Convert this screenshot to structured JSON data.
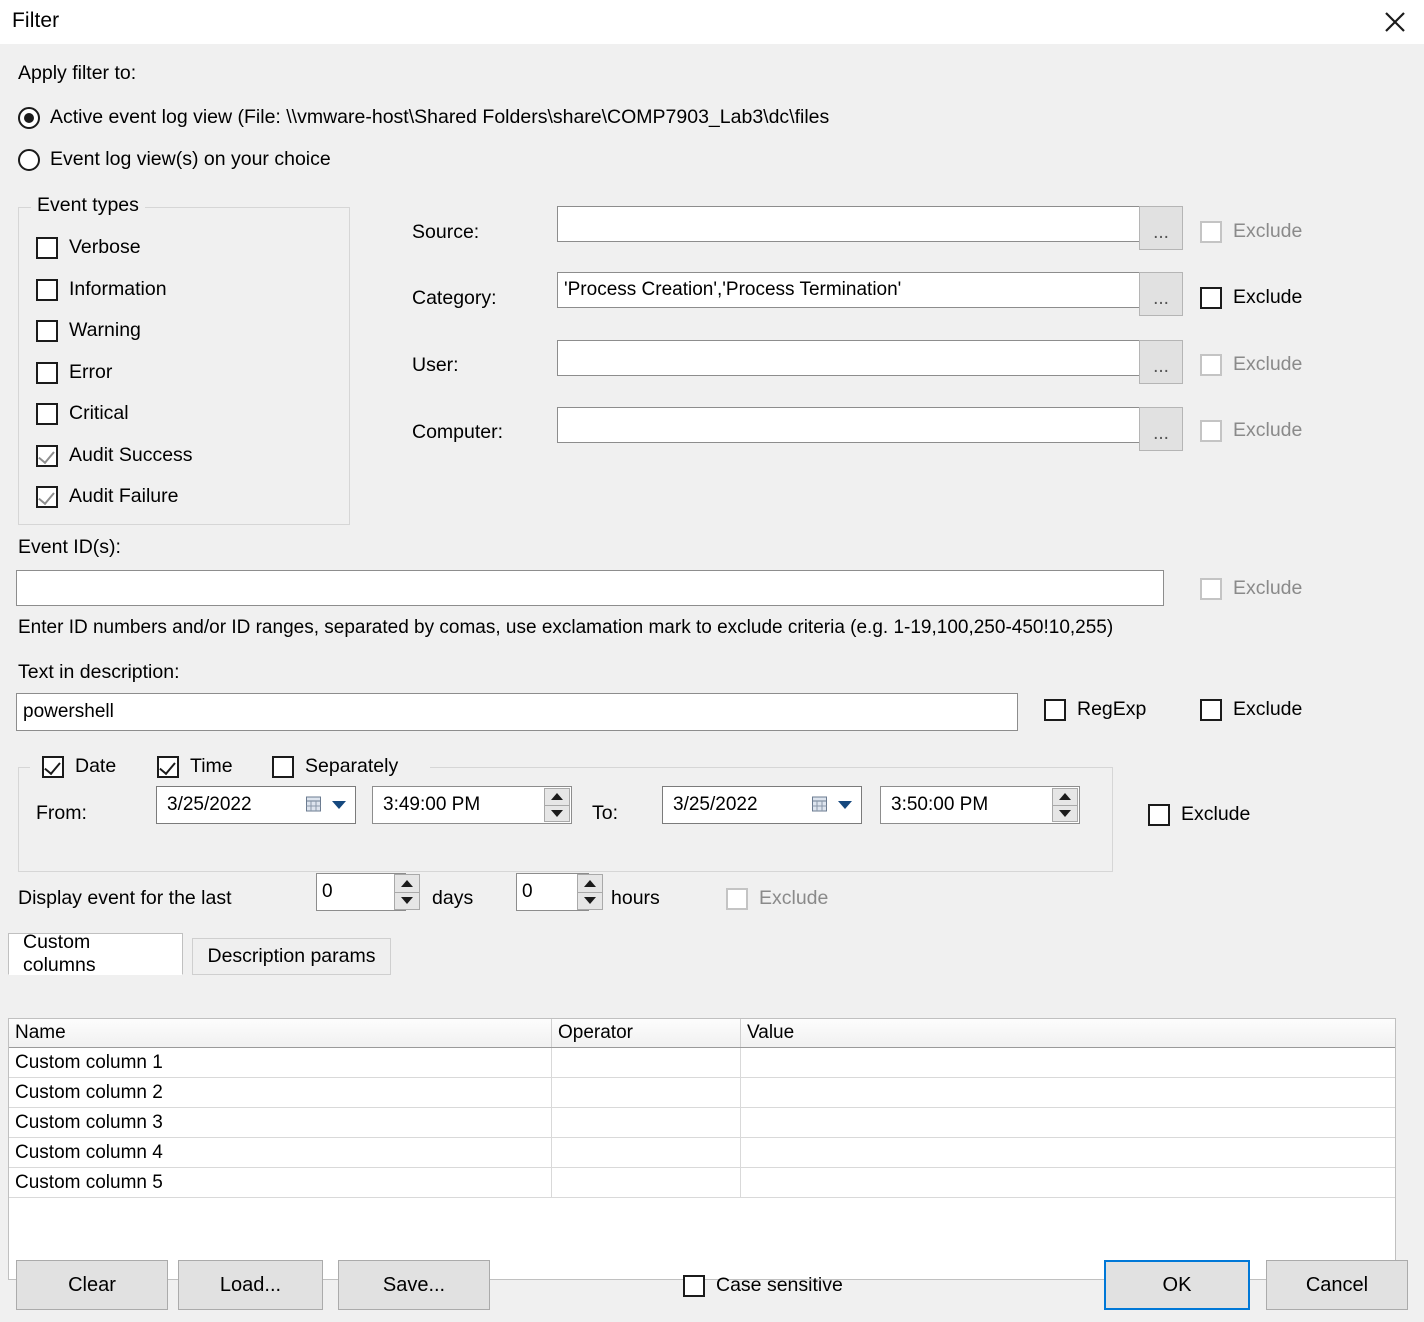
{
  "window": {
    "title": "Filter",
    "close_icon": "close-icon"
  },
  "apply_filter": {
    "label": "Apply filter to:",
    "options": [
      {
        "label": "Active event log view (File: \\\\vmware-host\\Shared Folders\\share\\COMP7903_Lab3\\dc\\files",
        "selected": true
      },
      {
        "label": "Event log view(s) on your choice",
        "selected": false
      }
    ]
  },
  "event_types": {
    "title": "Event types",
    "items": [
      {
        "label": "Verbose",
        "checked": false
      },
      {
        "label": "Information",
        "checked": false
      },
      {
        "label": "Warning",
        "checked": false
      },
      {
        "label": "Error",
        "checked": false
      },
      {
        "label": "Critical",
        "checked": false
      },
      {
        "label": "Audit Success",
        "checked": true
      },
      {
        "label": "Audit Failure",
        "checked": true
      }
    ]
  },
  "fields": {
    "source": {
      "label": "Source:",
      "value": "",
      "browse": "...",
      "exclude_label": "Exclude",
      "exclude_checked": false,
      "exclude_enabled": false
    },
    "category": {
      "label": "Category:",
      "value": "'Process Creation','Process Termination'",
      "browse": "...",
      "exclude_label": "Exclude",
      "exclude_checked": false,
      "exclude_enabled": true
    },
    "user": {
      "label": "User:",
      "value": "",
      "browse": "...",
      "exclude_label": "Exclude",
      "exclude_checked": false,
      "exclude_enabled": false
    },
    "computer": {
      "label": "Computer:",
      "value": "",
      "browse": "...",
      "exclude_label": "Exclude",
      "exclude_checked": false,
      "exclude_enabled": false
    }
  },
  "event_ids": {
    "label": "Event ID(s):",
    "value": "",
    "exclude_label": "Exclude",
    "exclude_enabled": false,
    "hint": "Enter ID numbers and/or ID ranges, separated by comas, use exclamation mark to exclude criteria (e.g. 1-19,100,250-450!10,255)"
  },
  "description": {
    "label": "Text in description:",
    "value": "powershell",
    "regexp_label": "RegExp",
    "regexp_checked": false,
    "exclude_label": "Exclude",
    "exclude_checked": false
  },
  "datetime": {
    "date_label": "Date",
    "date_checked": true,
    "time_label": "Time",
    "time_checked": true,
    "separately_label": "Separately",
    "separately_checked": false,
    "from_label": "From:",
    "from_date": "3/25/2022",
    "from_time": "3:49:00 PM",
    "to_label": "To:",
    "to_date": "3/25/2022",
    "to_time": "3:50:00 PM",
    "exclude_label": "Exclude",
    "exclude_checked": false
  },
  "last_period": {
    "label": "Display event for the last",
    "days_value": "0",
    "days_label": "days",
    "hours_value": "0",
    "hours_label": "hours",
    "exclude_label": "Exclude",
    "exclude_enabled": false
  },
  "tabs": [
    {
      "label": "Custom columns",
      "active": true
    },
    {
      "label": "Description params",
      "active": false
    }
  ],
  "table": {
    "columns": [
      "Name",
      "Operator",
      "Value"
    ],
    "rows": [
      [
        "Custom column 1",
        "",
        ""
      ],
      [
        "Custom column 2",
        "",
        ""
      ],
      [
        "Custom column 3",
        "",
        ""
      ],
      [
        "Custom column 4",
        "",
        ""
      ],
      [
        "Custom column 5",
        "",
        ""
      ]
    ]
  },
  "footer": {
    "clear": "Clear",
    "load": "Load...",
    "save": "Save...",
    "case_sensitive_label": "Case sensitive",
    "case_sensitive_checked": false,
    "ok": "OK",
    "cancel": "Cancel"
  }
}
